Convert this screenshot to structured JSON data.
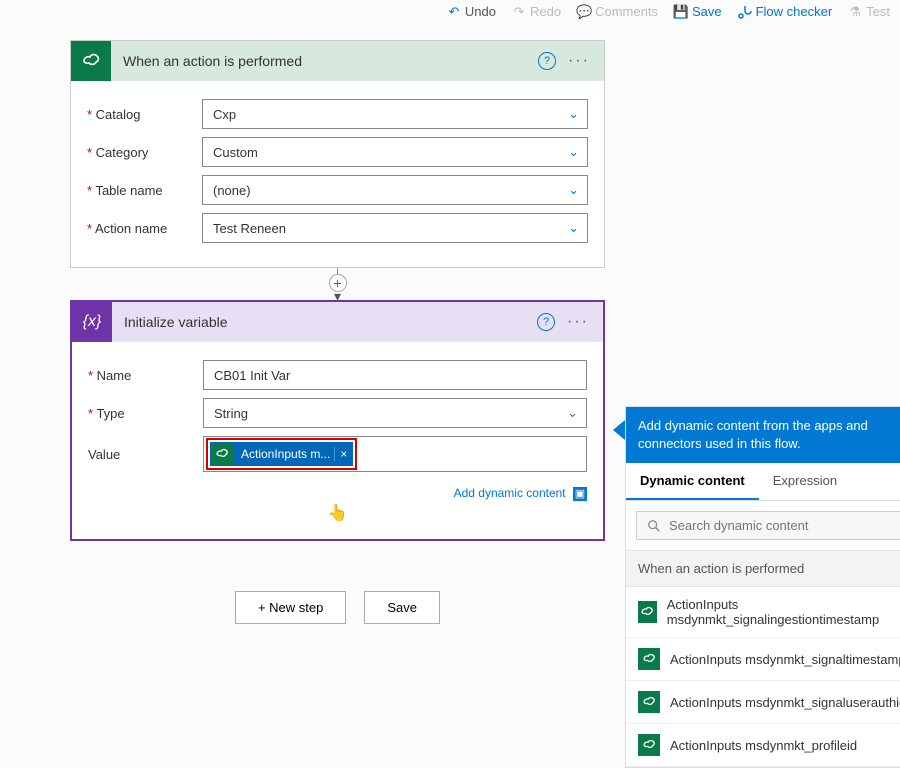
{
  "toolbar": {
    "undo": "Undo",
    "redo": "Redo",
    "comments": "Comments",
    "save": "Save",
    "flowchecker": "Flow checker",
    "test": "Test"
  },
  "trigger": {
    "title": "When an action is performed",
    "fields": {
      "catalog": {
        "label": "Catalog",
        "value": "Cxp"
      },
      "category": {
        "label": "Category",
        "value": "Custom"
      },
      "table": {
        "label": "Table name",
        "value": "(none)"
      },
      "action": {
        "label": "Action name",
        "value": "Test Reneen"
      }
    }
  },
  "action": {
    "title": "Initialize variable",
    "fields": {
      "name": {
        "label": "Name",
        "value": "CB01 Init Var"
      },
      "type": {
        "label": "Type",
        "value": "String"
      },
      "value": {
        "label": "Value",
        "token": "ActionInputs m..."
      }
    },
    "dynlink": "Add dynamic content"
  },
  "buttons": {
    "newstep": "+ New step",
    "save": "Save"
  },
  "dcpanel": {
    "hint": "Add dynamic content from the apps and connectors used in this flow.",
    "tabs": {
      "dynamic": "Dynamic content",
      "expression": "Expression"
    },
    "search_placeholder": "Search dynamic content",
    "section": "When an action is performed",
    "items": [
      "ActionInputs msdynmkt_signalingestiontimestamp",
      "ActionInputs msdynmkt_signaltimestamp",
      "ActionInputs msdynmkt_signaluserauthid",
      "ActionInputs msdynmkt_profileid"
    ]
  }
}
